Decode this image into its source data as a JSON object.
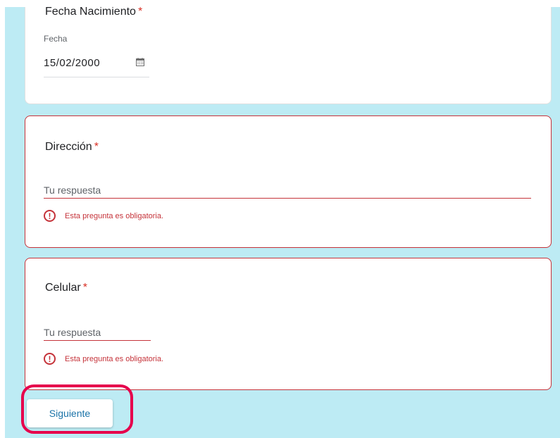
{
  "form": {
    "birth_date": {
      "title": "Fecha Nacimiento",
      "required_mark": "*",
      "sub_label": "Fecha",
      "value": "15/02/2000",
      "icon": "calendar-icon"
    },
    "address": {
      "title": "Dirección",
      "required_mark": "*",
      "placeholder": "Tu respuesta",
      "error": "Esta pregunta es obligatoria.",
      "error_icon": "exclamation-circle-icon",
      "error_symbol": "!"
    },
    "phone": {
      "title": "Celular",
      "required_mark": "*",
      "placeholder": "Tu respuesta",
      "error": "Esta pregunta es obligatoria.",
      "error_icon": "exclamation-circle-icon",
      "error_symbol": "!"
    },
    "next_button": "Siguiente"
  },
  "colors": {
    "background": "#bdebf4",
    "error": "#c5333a",
    "required": "#d93025",
    "button_text": "#1a73a8",
    "highlight": "#e6004c"
  }
}
